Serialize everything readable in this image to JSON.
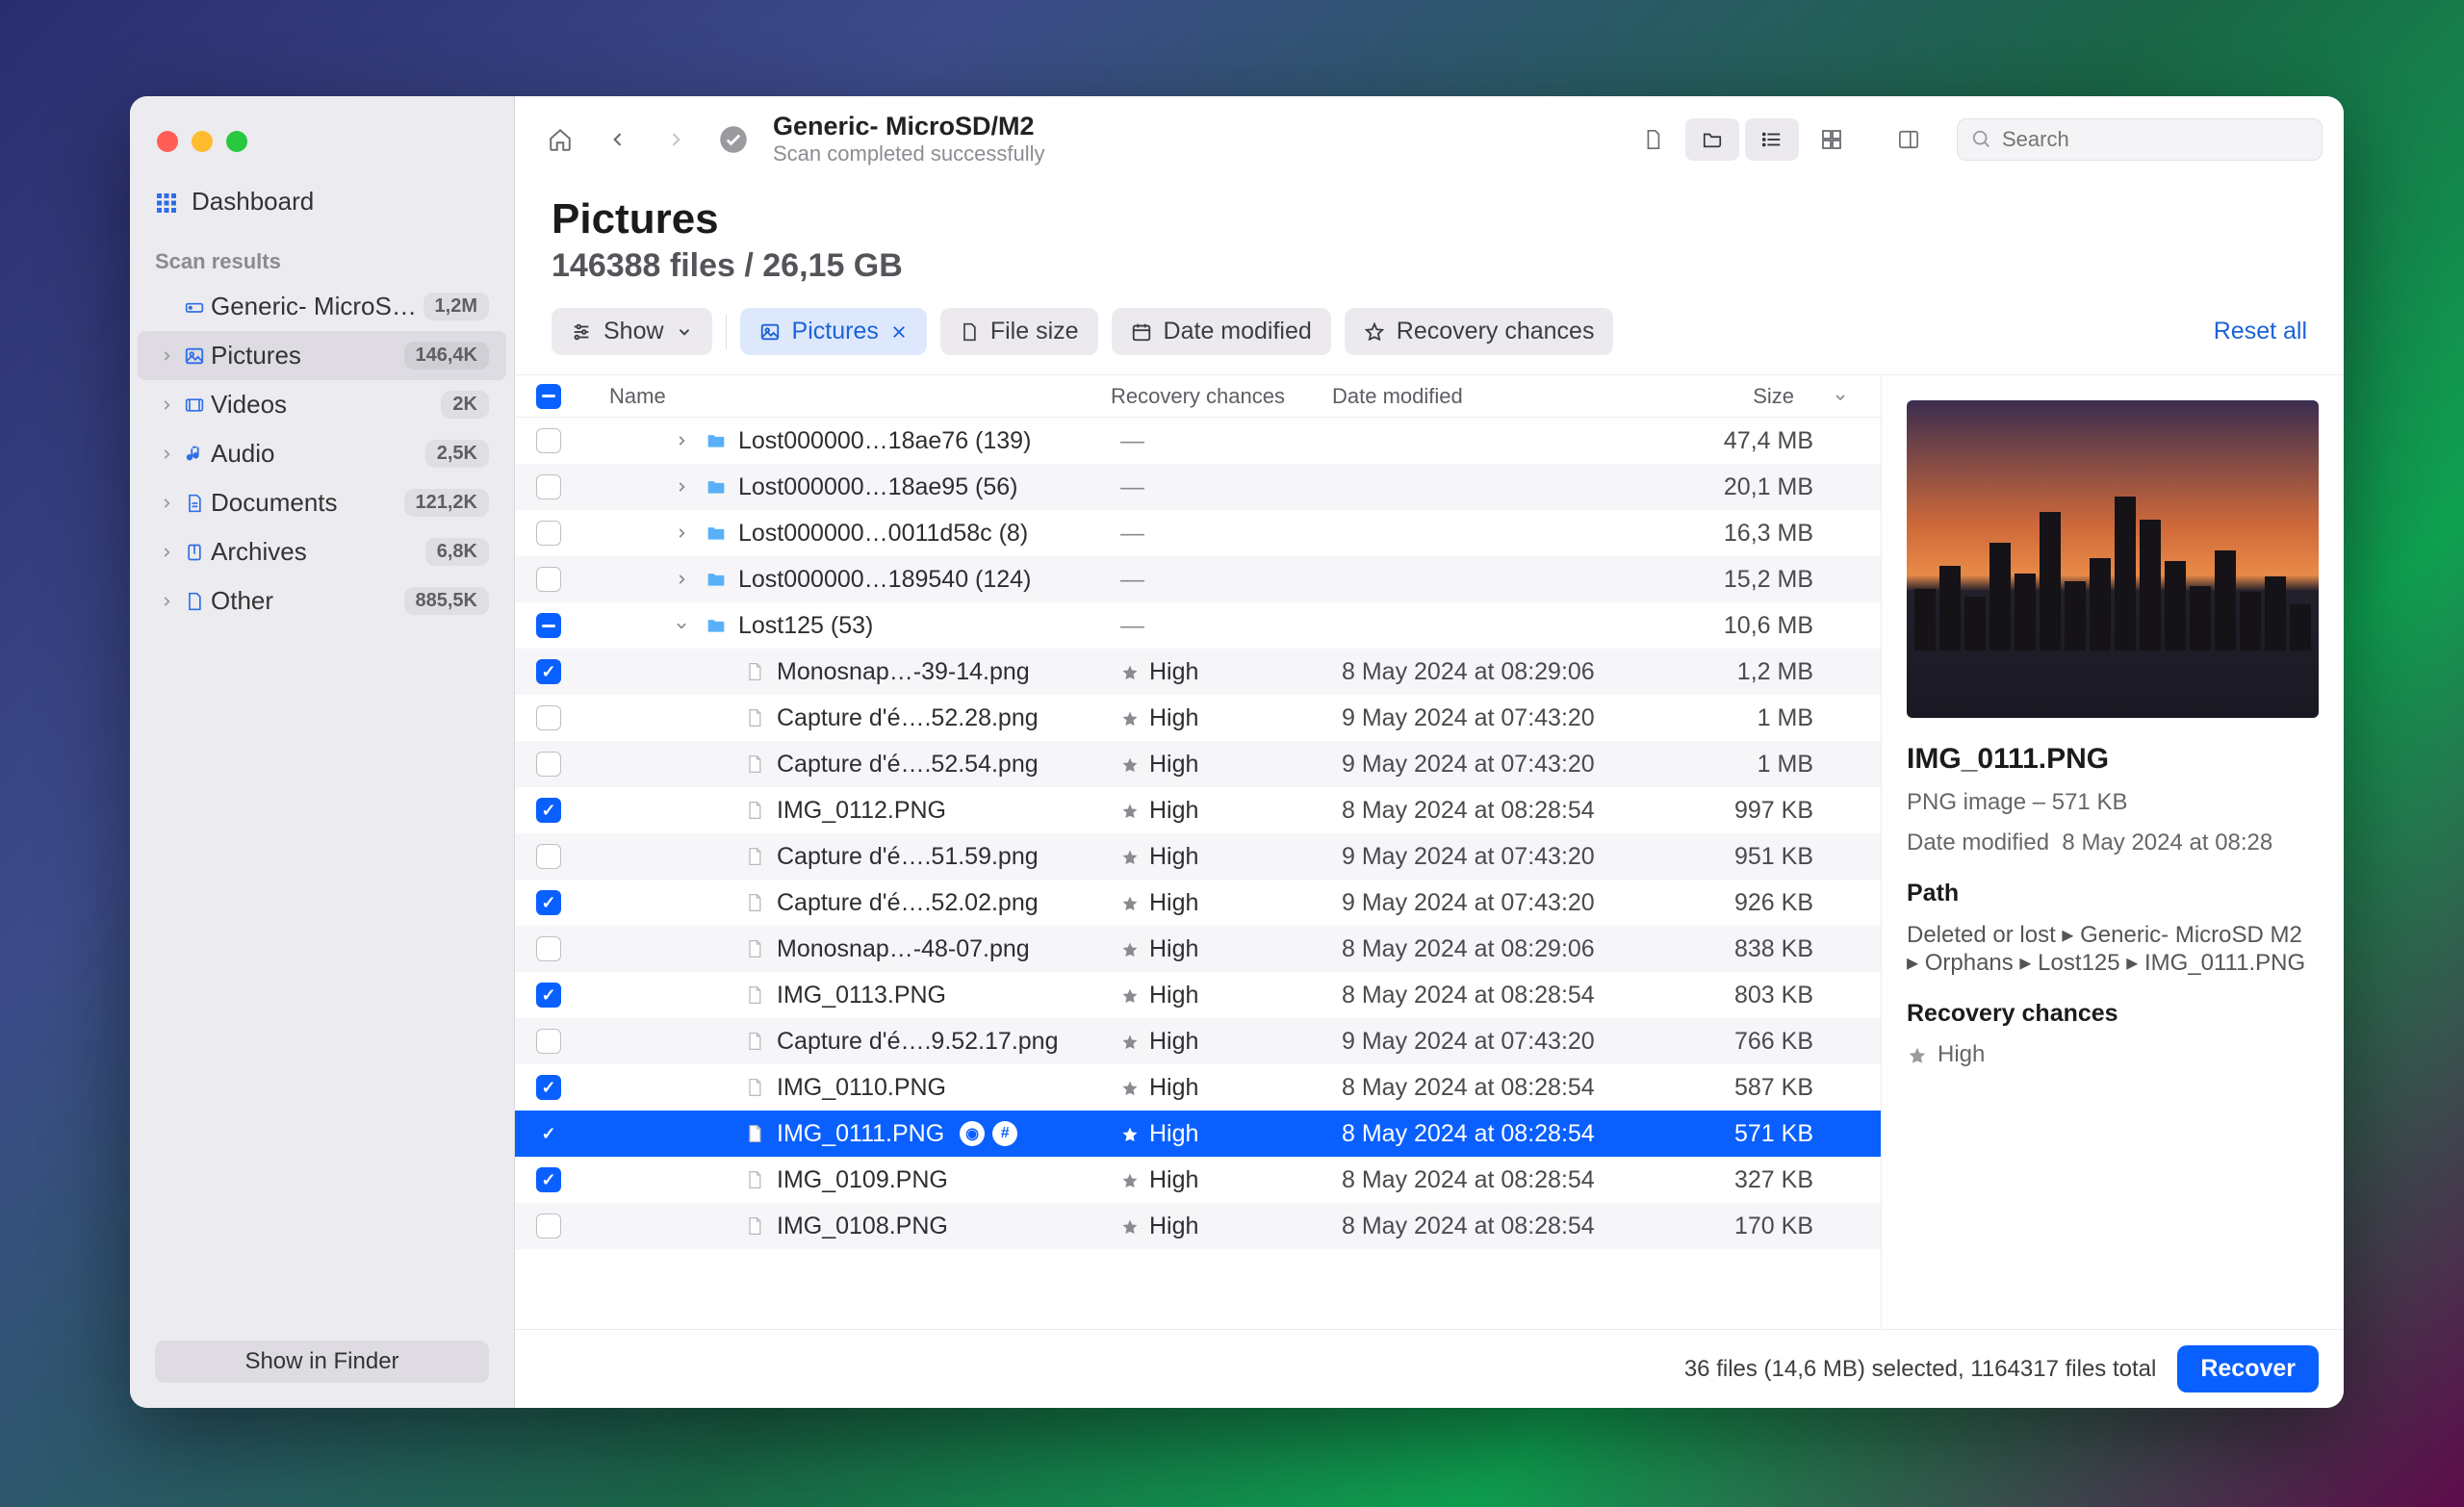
{
  "sidebar": {
    "dashboard_label": "Dashboard",
    "section_title": "Scan results",
    "items": [
      {
        "icon": "drive",
        "label": "Generic- MicroS…",
        "count": "1,2M",
        "active": false,
        "has_chevron": false
      },
      {
        "icon": "picture",
        "label": "Pictures",
        "count": "146,4K",
        "active": true,
        "has_chevron": true
      },
      {
        "icon": "video",
        "label": "Videos",
        "count": "2K",
        "active": false,
        "has_chevron": true
      },
      {
        "icon": "audio",
        "label": "Audio",
        "count": "2,5K",
        "active": false,
        "has_chevron": true
      },
      {
        "icon": "document",
        "label": "Documents",
        "count": "121,2K",
        "active": false,
        "has_chevron": true
      },
      {
        "icon": "archive",
        "label": "Archives",
        "count": "6,8K",
        "active": false,
        "has_chevron": true
      },
      {
        "icon": "other",
        "label": "Other",
        "count": "885,5K",
        "active": false,
        "has_chevron": true
      }
    ],
    "show_in_finder": "Show in Finder"
  },
  "toolbar": {
    "title": "Generic- MicroSD/M2",
    "subtitle": "Scan completed successfully",
    "search_placeholder": "Search"
  },
  "header": {
    "title": "Pictures",
    "subtitle": "146388 files / 26,15 GB"
  },
  "filters": {
    "show": "Show",
    "pictures": "Pictures",
    "file_size": "File size",
    "date_modified": "Date modified",
    "recovery_chances": "Recovery chances",
    "reset": "Reset all"
  },
  "table": {
    "columns": {
      "name": "Name",
      "recovery": "Recovery chances",
      "date": "Date modified",
      "size": "Size"
    },
    "rows": [
      {
        "check": "off",
        "type": "folder",
        "indent": 1,
        "expand": "closed",
        "name": "Lost000000…18ae76 (139)",
        "recov": "—",
        "date": "",
        "size": "47,4 MB"
      },
      {
        "check": "off",
        "type": "folder",
        "indent": 1,
        "expand": "closed",
        "name": "Lost000000…18ae95 (56)",
        "recov": "—",
        "date": "",
        "size": "20,1 MB"
      },
      {
        "check": "off",
        "type": "folder",
        "indent": 1,
        "expand": "closed",
        "name": "Lost000000…0011d58c (8)",
        "recov": "—",
        "date": "",
        "size": "16,3 MB"
      },
      {
        "check": "off",
        "type": "folder",
        "indent": 1,
        "expand": "closed",
        "name": "Lost000000…189540 (124)",
        "recov": "—",
        "date": "",
        "size": "15,2 MB"
      },
      {
        "check": "mixed",
        "type": "folder",
        "indent": 1,
        "expand": "open",
        "name": "Lost125 (53)",
        "recov": "—",
        "date": "",
        "size": "10,6 MB"
      },
      {
        "check": "on",
        "type": "file",
        "indent": 2,
        "name": "Monosnap…-39-14.png",
        "recov": "High",
        "date": "8 May 2024 at 08:29:06",
        "size": "1,2 MB"
      },
      {
        "check": "off",
        "type": "file",
        "indent": 2,
        "name": "Capture d'é….52.28.png",
        "recov": "High",
        "date": "9 May 2024 at 07:43:20",
        "size": "1 MB"
      },
      {
        "check": "off",
        "type": "file",
        "indent": 2,
        "name": "Capture d'é….52.54.png",
        "recov": "High",
        "date": "9 May 2024 at 07:43:20",
        "size": "1 MB"
      },
      {
        "check": "on",
        "type": "file",
        "indent": 2,
        "name": "IMG_0112.PNG",
        "recov": "High",
        "date": "8 May 2024 at 08:28:54",
        "size": "997 KB"
      },
      {
        "check": "off",
        "type": "file",
        "indent": 2,
        "name": "Capture d'é….51.59.png",
        "recov": "High",
        "date": "9 May 2024 at 07:43:20",
        "size": "951 KB"
      },
      {
        "check": "on",
        "type": "file",
        "indent": 2,
        "name": "Capture d'é….52.02.png",
        "recov": "High",
        "date": "9 May 2024 at 07:43:20",
        "size": "926 KB"
      },
      {
        "check": "off",
        "type": "file",
        "indent": 2,
        "name": "Monosnap…-48-07.png",
        "recov": "High",
        "date": "8 May 2024 at 08:29:06",
        "size": "838 KB"
      },
      {
        "check": "on",
        "type": "file",
        "indent": 2,
        "name": "IMG_0113.PNG",
        "recov": "High",
        "date": "8 May 2024 at 08:28:54",
        "size": "803 KB"
      },
      {
        "check": "off",
        "type": "file",
        "indent": 2,
        "name": "Capture d'é….9.52.17.png",
        "recov": "High",
        "date": "9 May 2024 at 07:43:20",
        "size": "766 KB"
      },
      {
        "check": "on",
        "type": "file",
        "indent": 2,
        "name": "IMG_0110.PNG",
        "recov": "High",
        "date": "8 May 2024 at 08:28:54",
        "size": "587 KB"
      },
      {
        "check": "on",
        "type": "file",
        "indent": 2,
        "name": "IMG_0111.PNG",
        "recov": "High",
        "date": "8 May 2024 at 08:28:54",
        "size": "571 KB",
        "selected": true,
        "badges": true
      },
      {
        "check": "on",
        "type": "file",
        "indent": 2,
        "name": "IMG_0109.PNG",
        "recov": "High",
        "date": "8 May 2024 at 08:28:54",
        "size": "327 KB"
      },
      {
        "check": "off",
        "type": "file",
        "indent": 2,
        "name": "IMG_0108.PNG",
        "recov": "High",
        "date": "8 May 2024 at 08:28:54",
        "size": "170 KB"
      }
    ]
  },
  "details": {
    "filename": "IMG_0111.PNG",
    "meta": "PNG image – 571 KB",
    "date_label": "Date modified",
    "date_value": "8 May 2024 at 08:28",
    "path_label": "Path",
    "path_value": "Deleted or lost ▸ Generic- MicroSD M2 ▸ Orphans ▸ Lost125 ▸ IMG_0111.PNG",
    "recov_label": "Recovery chances",
    "recov_value": "High"
  },
  "footer": {
    "status": "36 files (14,6 MB) selected, 1164317 files total",
    "recover": "Recover"
  }
}
